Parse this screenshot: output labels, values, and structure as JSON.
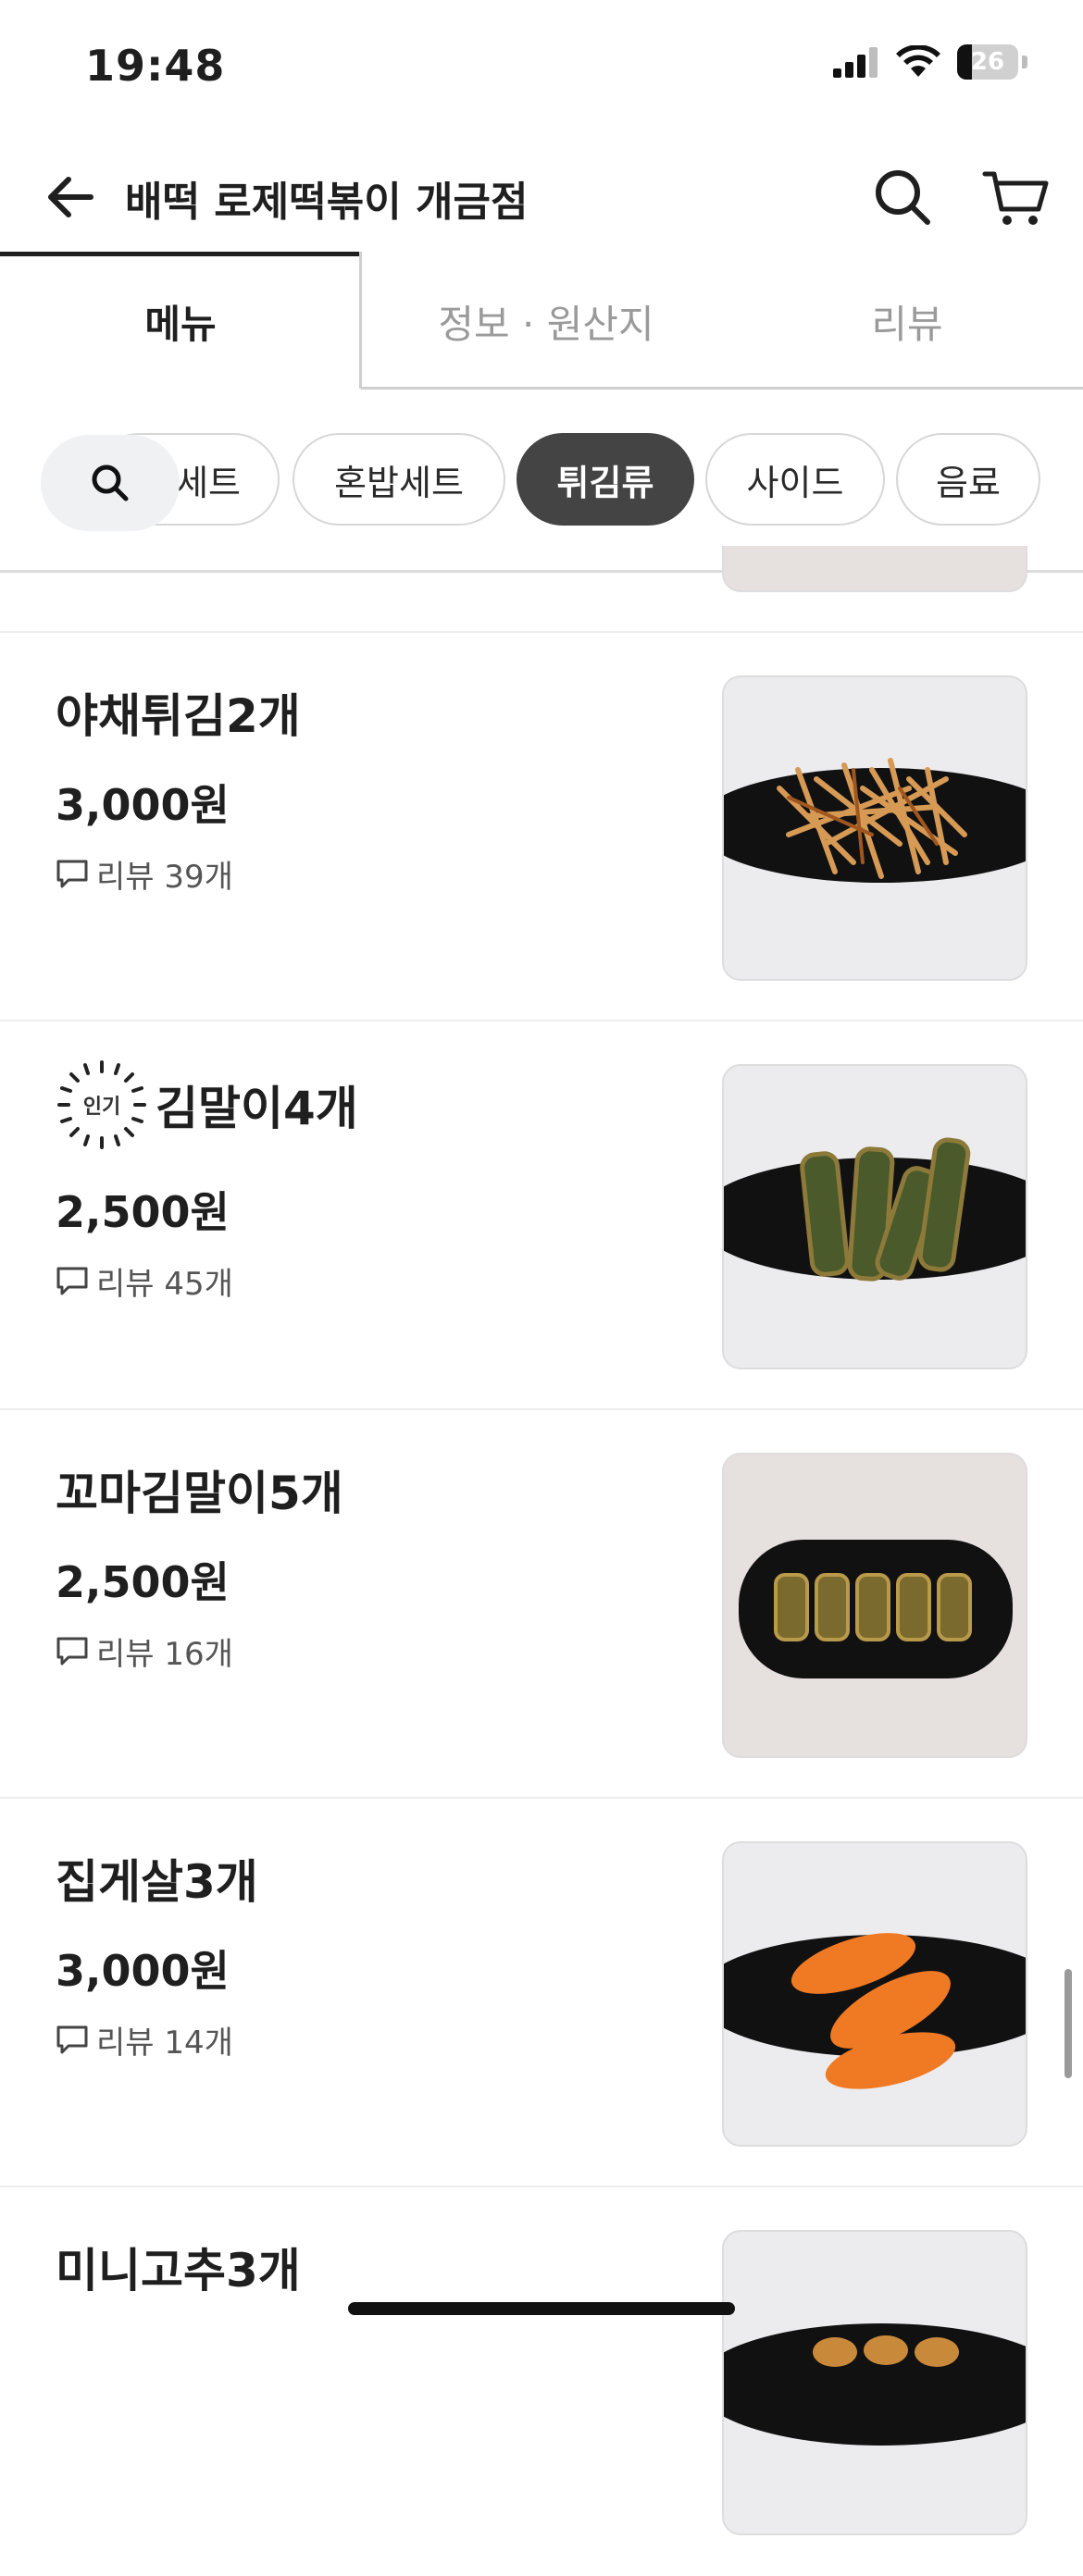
{
  "status_bar": {
    "time": "19:48",
    "battery": "26"
  },
  "header": {
    "title": "배떡 로제떡볶이 개금점"
  },
  "tabs": [
    {
      "label": "메뉴",
      "active": true
    },
    {
      "label": "정보 · 원산지",
      "active": false
    },
    {
      "label": "리뷰",
      "active": false
    }
  ],
  "chips": [
    {
      "label": "세트",
      "active": false
    },
    {
      "label": "혼밥세트",
      "active": false
    },
    {
      "label": "튀김류",
      "active": true
    },
    {
      "label": "사이드",
      "active": false
    },
    {
      "label": "음료",
      "active": false
    }
  ],
  "menu_items": [
    {
      "name": "야채튀김2개",
      "price": "3,000원",
      "review": "리뷰 39개",
      "popular": false
    },
    {
      "name": "김말이4개",
      "price": "2,500원",
      "review": "리뷰 45개",
      "popular": true,
      "badge": "인기"
    },
    {
      "name": "꼬마김말이5개",
      "price": "2,500원",
      "review": "리뷰 16개",
      "popular": false
    },
    {
      "name": "집게살3개",
      "price": "3,000원",
      "review": "리뷰 14개",
      "popular": false
    },
    {
      "name": "미니고추3개",
      "price": "",
      "review": "",
      "popular": false
    }
  ],
  "colors": {
    "accent_dark": "#444444",
    "text": "#1f1f1f",
    "muted": "#9a9a9a",
    "plate": "#111111"
  }
}
